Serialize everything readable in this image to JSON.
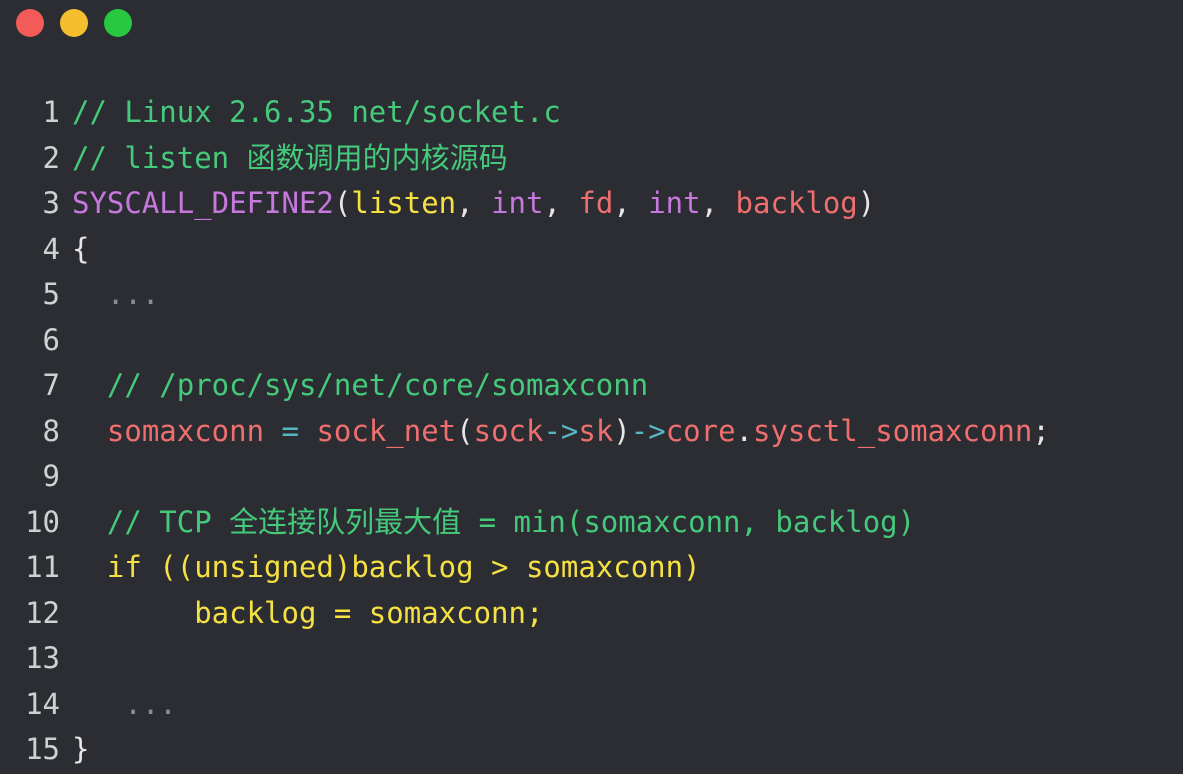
{
  "window": {
    "controls": [
      {
        "name": "close",
        "color": "#f25b57"
      },
      {
        "name": "minimize",
        "color": "#f5be2e"
      },
      {
        "name": "maximize",
        "color": "#28c840"
      }
    ]
  },
  "theme": {
    "background": "#2b2d33",
    "line_number": "#cfd0d2",
    "comment": "#45c97b",
    "keyword_purple": "#c678dd",
    "identifier_yellow": "#f5e142",
    "param_red": "#ef6f6f",
    "operator_cyan": "#56b6c2",
    "punct": "#e6e6e6",
    "dim": "#8a8d93"
  },
  "code_lines": [
    {
      "n": "1",
      "tokens": [
        {
          "t": "// Linux 2.6.35 net/socket.c",
          "c": "comment"
        }
      ]
    },
    {
      "n": "2",
      "tokens": [
        {
          "t": "// listen 函数调用的内核源码",
          "c": "comment"
        }
      ]
    },
    {
      "n": "3",
      "tokens": [
        {
          "t": "SYSCALL_DEFINE2",
          "c": "keyword_purple"
        },
        {
          "t": "(",
          "c": "punct"
        },
        {
          "t": "listen",
          "c": "identifier_yellow"
        },
        {
          "t": ", ",
          "c": "punct"
        },
        {
          "t": "int",
          "c": "keyword_purple"
        },
        {
          "t": ", ",
          "c": "punct"
        },
        {
          "t": "fd",
          "c": "param_red"
        },
        {
          "t": ", ",
          "c": "punct"
        },
        {
          "t": "int",
          "c": "keyword_purple"
        },
        {
          "t": ", ",
          "c": "punct"
        },
        {
          "t": "backlog",
          "c": "param_red"
        },
        {
          "t": ")",
          "c": "punct"
        }
      ]
    },
    {
      "n": "4",
      "tokens": [
        {
          "t": "{",
          "c": "punct"
        }
      ]
    },
    {
      "n": "5",
      "tokens": [
        {
          "t": "  ...",
          "c": "dim"
        }
      ]
    },
    {
      "n": "6",
      "tokens": []
    },
    {
      "n": "7",
      "tokens": [
        {
          "t": "  // /proc/sys/net/core/somaxconn",
          "c": "comment"
        }
      ]
    },
    {
      "n": "8",
      "tokens": [
        {
          "t": "  somaxconn",
          "c": "param_red"
        },
        {
          "t": " = ",
          "c": "operator_cyan"
        },
        {
          "t": "sock_net",
          "c": "param_red"
        },
        {
          "t": "(",
          "c": "punct"
        },
        {
          "t": "sock",
          "c": "param_red"
        },
        {
          "t": "->",
          "c": "operator_cyan"
        },
        {
          "t": "sk",
          "c": "param_red"
        },
        {
          "t": ")",
          "c": "punct"
        },
        {
          "t": "->",
          "c": "operator_cyan"
        },
        {
          "t": "core",
          "c": "param_red"
        },
        {
          "t": ".",
          "c": "punct"
        },
        {
          "t": "sysctl_somaxconn",
          "c": "param_red"
        },
        {
          "t": ";",
          "c": "punct"
        }
      ]
    },
    {
      "n": "9",
      "tokens": []
    },
    {
      "n": "10",
      "tokens": [
        {
          "t": "  // TCP 全连接队列最大值 = min(somaxconn, backlog)",
          "c": "comment"
        }
      ]
    },
    {
      "n": "11",
      "tokens": [
        {
          "t": "  if ((unsigned)backlog > somaxconn)",
          "c": "identifier_yellow"
        }
      ]
    },
    {
      "n": "12",
      "tokens": [
        {
          "t": "       backlog = somaxconn;",
          "c": "identifier_yellow"
        }
      ]
    },
    {
      "n": "13",
      "tokens": []
    },
    {
      "n": "14",
      "tokens": [
        {
          "t": "   ...",
          "c": "dim"
        }
      ]
    },
    {
      "n": "15",
      "tokens": [
        {
          "t": "}",
          "c": "punct"
        }
      ]
    }
  ]
}
